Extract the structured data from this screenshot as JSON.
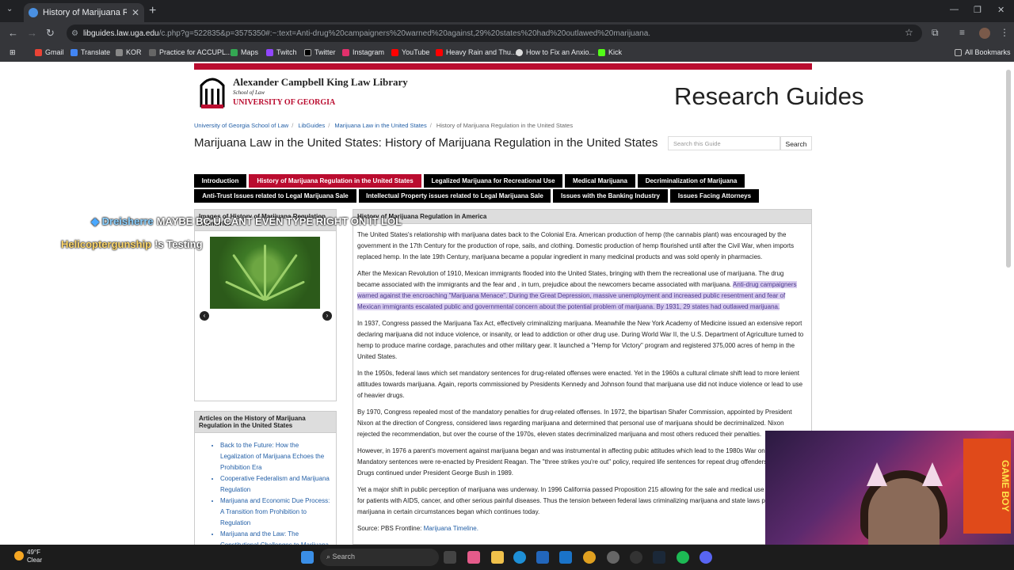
{
  "browser": {
    "tab_title": "History of Marijuana Regulation",
    "tab_close": "✕",
    "new_tab": "+",
    "url_host": "libguides.law.uga.edu",
    "url_rest": "/c.php?g=522835&p=3575350#:~:text=Anti-drug%20campaigners%20warned%20against,29%20states%20had%20outlawed%20marijuana.",
    "bookmarks": [
      "Gmail",
      "Translate",
      "KOR",
      "Practice for ACCUPL...",
      "Maps",
      "Twitch",
      "Twitter",
      "Instagram",
      "YouTube",
      "Heavy Rain and Thu...",
      "How to Fix an Anxio...",
      "Kick"
    ],
    "all_bookmarks": "All Bookmarks"
  },
  "header": {
    "library_name": "Alexander Campbell King Law Library",
    "school": "School of Law",
    "university": "UNIVERSITY OF GEORGIA",
    "research_guides": "Research Guides"
  },
  "breadcrumbs": [
    "University of Georgia School of Law",
    "LibGuides",
    "Marijuana Law in the United States",
    "History of Marijuana Regulation in the United States"
  ],
  "page_title": "Marijuana Law in the United States: History of Marijuana Regulation in the United States",
  "search": {
    "placeholder": "Search this Guide",
    "button": "Search"
  },
  "nav_tabs": [
    "Introduction",
    "History of Marijuana Regulation in the United States",
    "Legalized Marijuana for Recreational Use",
    "Medical Marijuana",
    "Decriminalization of Marijuana",
    "Anti-Trust Issues related to Legal Marijuana Sale",
    "Intellectual Property issues related to Legal Marijuana Sale",
    "Issues with the Banking Industry",
    "Issues Facing Attorneys"
  ],
  "images_box": {
    "title": "Images of History of Marijuana Regulation in America",
    "prev": "‹",
    "next": "›"
  },
  "articles_box": {
    "title": "Articles on the History of Marijuana Regulation in the United States",
    "items": [
      "Back to the Future: How the Legalization of Marijuana Echoes the Prohibition Era",
      "Cooperative Federalism and Marijuana Regulation",
      "Marijuana and Economic Due Process: A Transition from Prohibition to Regulation",
      "Marijuana and the Law: The Constitutional Challenges to Marijuana"
    ]
  },
  "main": {
    "title": "History of Marijuana Regulation in America",
    "p1": "The United States's relationship with marijuana dates back to the Colonial Era. American production of hemp (the cannabis plant) was encouraged by the government in the 17th Century for the production of rope, sails, and clothing. Domestic production of hemp flourished until after the Civil War, when imports replaced hemp. In the late 19th Century, marijuana became a popular ingredient in many medicinal products and was sold openly in pharmacies.",
    "p2a": "After the Mexican Revolution of 1910, Mexican immigrants flooded into the United States, bringing with them the recreational use of marijuana. The drug became associated with the immigrants and the fear and , in turn, prejudice about the newcomers became associated with marijuana. ",
    "p2b": "Anti-drug campaigners warned against the encroaching \"Marijuana Menace\". During the Great Depression, massive unemployment and increased public resentment and fear of Mexican immigrants escalated public and governmental concern about the potential problem of marijuana. By 1931, 29 states had outlawed marijuana.",
    "p3": "In 1937, Congress passed the Marijuana Tax Act, effectively criminalizing marijuana. Meanwhile the New York Academy of Medicine issued an extensive report declaring marijuana did not induce violence, or insanity, or lead to addiction or other drug use. During World War II, the U.S. Department of Agriculture turned to hemp to produce marine cordage, parachutes and other military gear.  It launched a \"Hemp for Victory\" program and registered 375,000 acres of hemp in the United States.",
    "p4": "In the 1950s, federal laws which set mandatory sentences for drug-related offenses were enacted. Yet in the 1960s a cultural climate shift lead to more lenient attitudes towards marijuana. Again, reports commissioned by Presidents Kennedy and Johnson found that marijuana use did not induce violence or lead to use of heavier drugs.",
    "p5": "By 1970, Congress repealed most of the mandatory penalties for drug-related offenses. In 1972, the bipartisan Shafer Commission, appointed by President Nixon at the direction of Congress, considered laws regarding marijuana and determined that personal use of marijuana should be decriminalized. Nixon rejected the recommendation, but over the course of the 1970s, eleven states decriminalized marijuana and most others reduced their penalties.",
    "p6": "However, in 1976 a parent's movement against marijuana began and was instrumental in affecting pubic attitudes which lead to the 1980s War on Drugs. Mandatory sentences were re-enacted by President Reagan. The \"three strikes you're out\" policy, required life sentences for repeat drug offenders. The War on Drugs continued under President George Bush in 1989.",
    "p7": "Yet a major shift in public perception of marijuana was underway. In 1996 California passed Proposition 215 allowing for the sale and medical use of marijuana for patients with AIDS, cancer, and other serious painful diseases. Thus the tension between federal laws criminalizing marijuana and state laws permitting marijuana in certain circumstances began which continues today.",
    "source_label": "Source: PBS Frontline: ",
    "source_link": "Marijuana Timeline."
  },
  "overlay": {
    "chat1_user": "Dreisherre",
    "chat1_msg": "MAYBE BC U CANT EVEN TYPE RIGHT ON IT LOL",
    "chat2_user": "Helicoptergunship",
    "chat2_msg": "!s Testing"
  },
  "webcam_poster": "GAME BOY",
  "taskbar": {
    "temp": "49°F",
    "condition": "Clear",
    "search": "Search"
  }
}
